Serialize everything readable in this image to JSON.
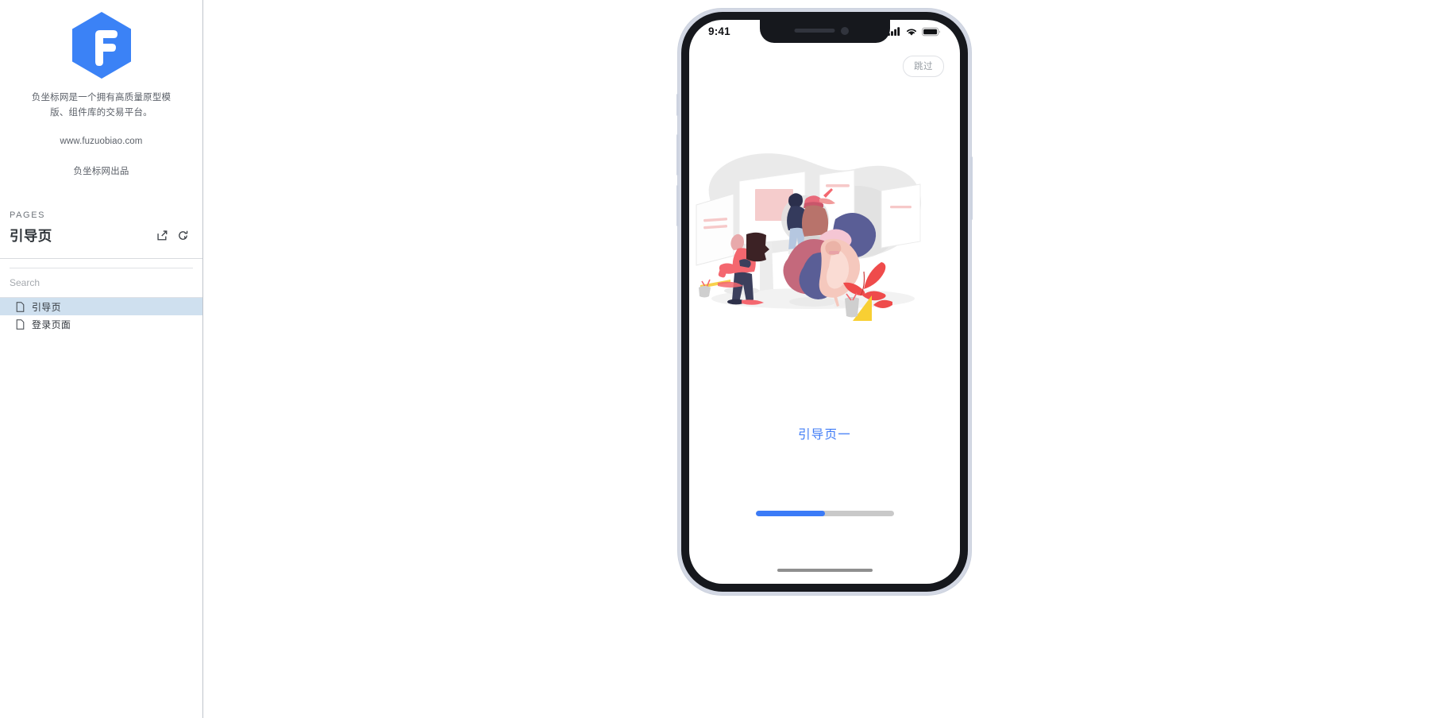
{
  "sidebar": {
    "logo": {
      "icon": "hexagon-f-logo",
      "color": "#3b82f6"
    },
    "brand_description": "负坐标网是一个拥有高质量原型模版、组件库的交易平台。",
    "brand_url": "www.fuzuobiao.com",
    "brand_byline": "负坐标网出品",
    "pages_label": "PAGES",
    "pages_title": "引导页",
    "actions": [
      {
        "name": "export-icon",
        "title": "导出"
      },
      {
        "name": "refresh-icon",
        "title": "刷新"
      }
    ],
    "search": {
      "placeholder": "Search",
      "value": ""
    },
    "pages": [
      {
        "label": "引导页",
        "icon": "document-icon",
        "active": true
      },
      {
        "label": "登录页面",
        "icon": "document-icon",
        "active": false
      }
    ]
  },
  "preview": {
    "device": "iPhone",
    "statusbar": {
      "time": "9:41",
      "signal_icon": "cellular-signal-icon",
      "wifi_icon": "wifi-icon",
      "battery_icon": "battery-full-icon"
    },
    "skip_button": "跳过",
    "illustration": {
      "name": "art-gallery-illustration",
      "alt": "人们在美术馆中欣赏画作的插画"
    },
    "page_title": "引导页一",
    "progress": {
      "percent": 50,
      "fill_color": "#3b7bf7",
      "track_color": "#c9c9c9"
    },
    "home_indicator": true
  },
  "colors": {
    "accent": "#3b7bf7",
    "sidebar_border": "#bfc4cb",
    "active_row": "#cfe0ef",
    "text_primary": "#31363c",
    "text_muted": "#6e737a"
  }
}
